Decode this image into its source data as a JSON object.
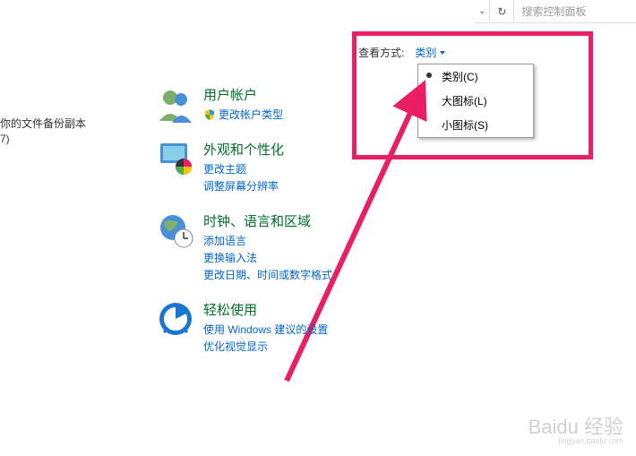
{
  "topbar": {
    "search_placeholder": "搜索控制面板"
  },
  "left_fragment": {
    "line1": "你的文件备份副本",
    "line2": "7)"
  },
  "view_mode": {
    "label": "查看方式:",
    "current": "类别",
    "options": [
      {
        "label": "类别(C)",
        "selected": true
      },
      {
        "label": "大图标(L)",
        "selected": false
      },
      {
        "label": "小图标(S)",
        "selected": false
      }
    ]
  },
  "categories": [
    {
      "title": "用户帐户",
      "links": [
        {
          "text": "更改帐户类型",
          "shield": true
        }
      ]
    },
    {
      "title": "外观和个性化",
      "links": [
        {
          "text": "更改主题",
          "shield": false
        },
        {
          "text": "调整屏幕分辨率",
          "shield": false
        }
      ]
    },
    {
      "title": "时钟、语言和区域",
      "links": [
        {
          "text": "添加语言",
          "shield": false
        },
        {
          "text": "更换输入法",
          "shield": false
        },
        {
          "text": "更改日期、时间或数字格式",
          "shield": false
        }
      ]
    },
    {
      "title": "轻松使用",
      "links": [
        {
          "text": "使用 Windows 建议的设置",
          "shield": false
        },
        {
          "text": "优化视觉显示",
          "shield": false
        }
      ]
    }
  ],
  "watermark": {
    "brand": "Baidu 经验",
    "sub": "jingyan.baidu.com"
  }
}
